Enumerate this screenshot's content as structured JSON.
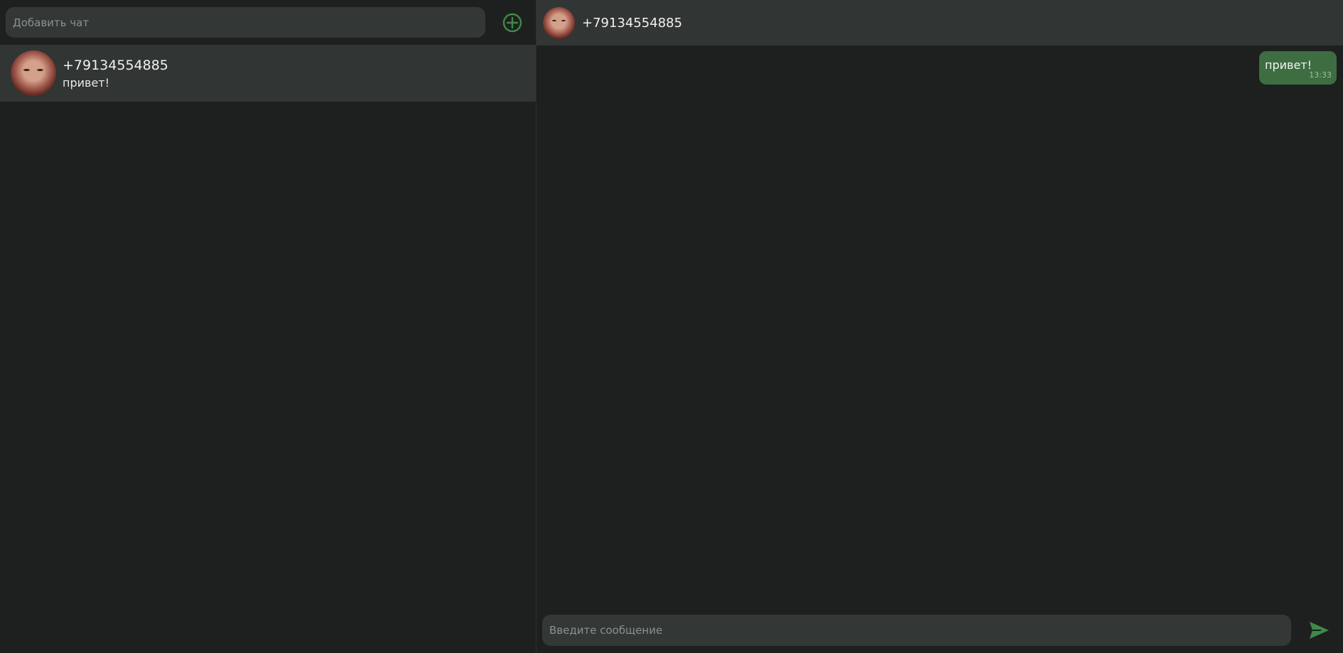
{
  "sidebar": {
    "add_chat": {
      "placeholder": "Добавить чат"
    },
    "chats": [
      {
        "name": "+79134554885",
        "last_message": "привет!"
      }
    ]
  },
  "conversation": {
    "header_name": "+79134554885",
    "messages": [
      {
        "text": "привет!",
        "time": "13:33",
        "outgoing": true
      }
    ],
    "composer": {
      "placeholder": "Введите сообщение"
    }
  },
  "colors": {
    "background": "#1e201f",
    "panel": "#313533",
    "input": "#333735",
    "accent": "#3e6d42",
    "icon": "#3f8a47"
  },
  "icons": {
    "add_chat": "plus-circle-icon",
    "send": "send-icon"
  }
}
